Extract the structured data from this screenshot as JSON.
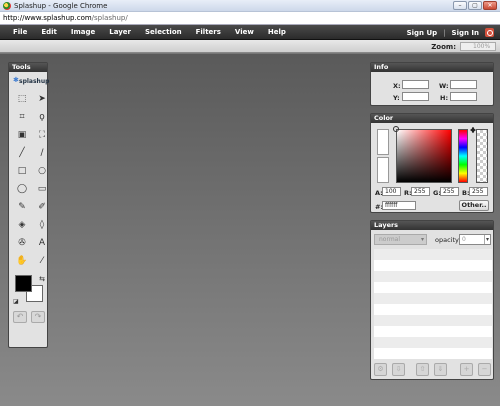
{
  "window": {
    "title": "Splashup - Google Chrome",
    "minimize": "–",
    "restore": "▢",
    "close": "✕"
  },
  "address": {
    "host": "http://www.splashup.com",
    "path": "/splashup/"
  },
  "menu": {
    "items": [
      "File",
      "Edit",
      "Image",
      "Layer",
      "Selection",
      "Filters",
      "View",
      "Help"
    ],
    "sign_up": "Sign Up",
    "separator": "|",
    "sign_in": "Sign In"
  },
  "zoom": {
    "label": "Zoom:",
    "value": "100%"
  },
  "tools": {
    "title": "Tools",
    "logo_text": "splashup",
    "icons": [
      "marquee-rect",
      "move",
      "crop",
      "lasso",
      "transform",
      "magic-select",
      "pencil",
      "line",
      "rectangle",
      "ellipse",
      "rounded-rect",
      "rounded-rect-alt",
      "brush",
      "smudge",
      "fill",
      "eraser",
      "clone",
      "text",
      "hand",
      "eyedropper"
    ]
  },
  "info": {
    "title": "Info",
    "x_label": "X:",
    "y_label": "Y:",
    "w_label": "W:",
    "h_label": "H:"
  },
  "color": {
    "title": "Color",
    "a_label": "A:",
    "a_value": "100",
    "r_label": "R:",
    "r_value": "255",
    "g_label": "G:",
    "g_value": "255",
    "b_label": "B:",
    "b_value": "255",
    "hex_label": "#:",
    "hex_value": "ffffff",
    "other_button": "Other..",
    "foreground": "#000000",
    "background": "#ffffff"
  },
  "layers": {
    "title": "Layers",
    "blend_mode": "normal",
    "opacity_label": "opacity:",
    "opacity_value": "0"
  }
}
